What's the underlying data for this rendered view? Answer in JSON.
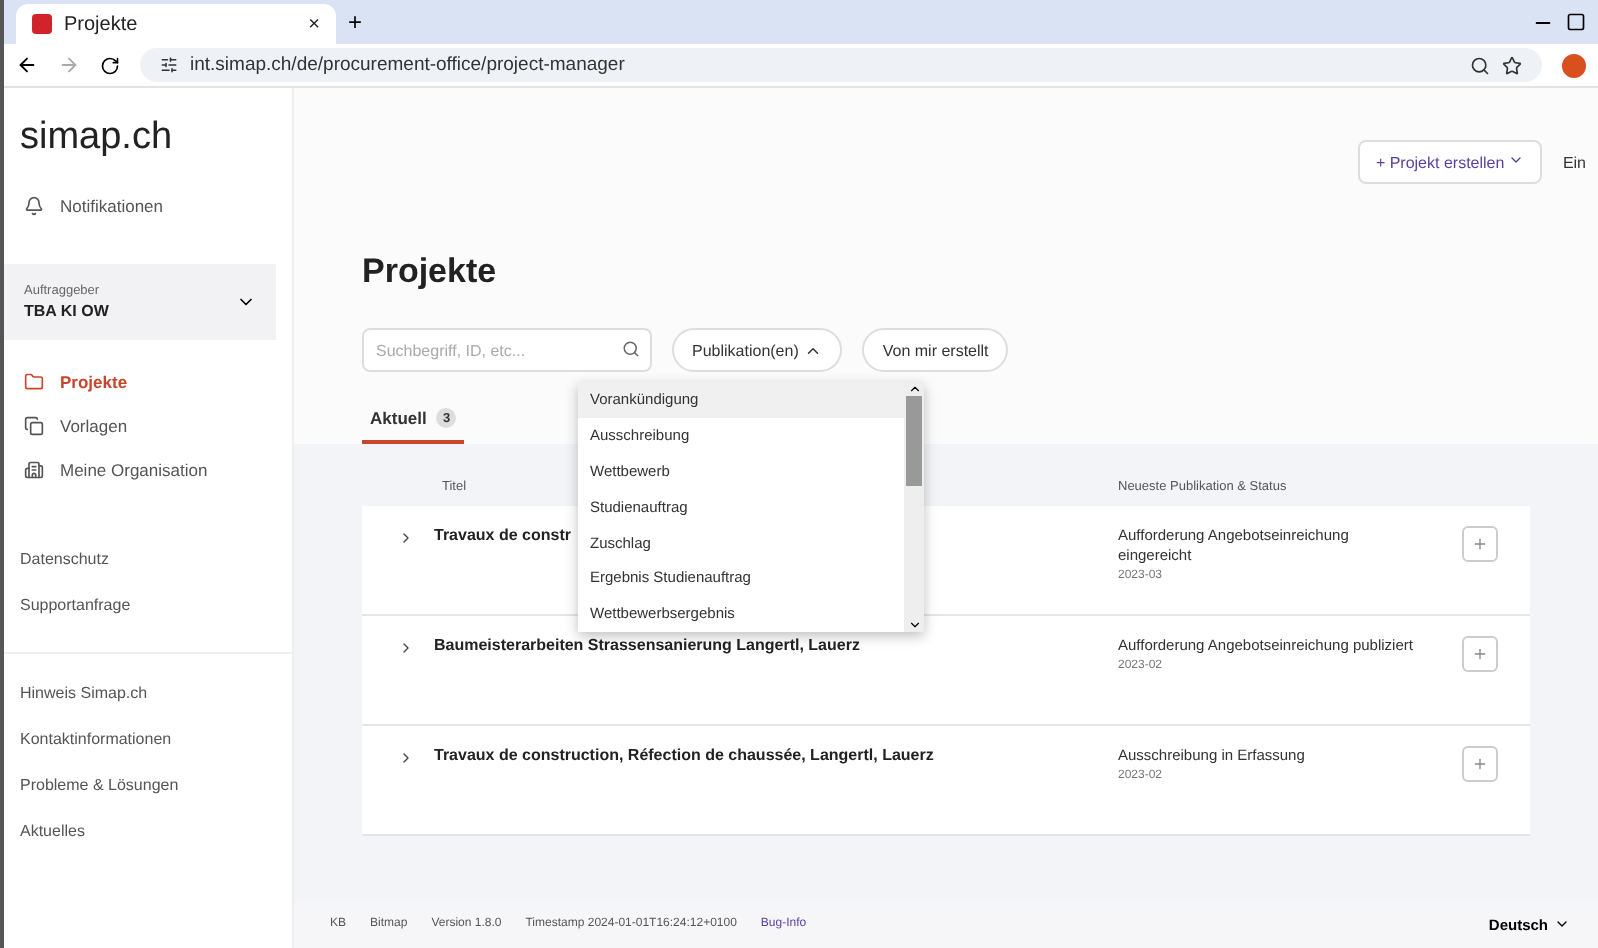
{
  "browser": {
    "tab_title": "Projekte",
    "tab_close": "×",
    "new_tab": "+",
    "url": "int.simap.ch/de/procurement-office/project-manager"
  },
  "sidebar": {
    "logo": "simap.ch",
    "notifications": "Notifikationen",
    "org": {
      "label": "Auftraggeber",
      "name": "TBA KI OW"
    },
    "nav": [
      {
        "label": "Projekte",
        "selected": true
      },
      {
        "label": "Vorlagen",
        "selected": false
      },
      {
        "label": "Meine Organisation",
        "selected": false
      }
    ],
    "links": [
      "Datenschutz",
      "Supportanfrage"
    ],
    "footer_links": [
      "Hinweis Simap.ch",
      "Kontaktinformationen",
      "Probleme & Lösungen",
      "Aktuelles"
    ]
  },
  "header": {
    "create_button": "+ Projekt erstellen",
    "user": "Ein"
  },
  "page": {
    "title": "Projekte",
    "search": {
      "placeholder": "Suchbegriff, ID, etc..."
    },
    "filter": "Publikation(en)",
    "mine": "Von mir erstellt",
    "tabs": [
      {
        "label": "Aktuell",
        "count": "3",
        "selected": true
      }
    ],
    "columns": [
      "Titel",
      "Neueste Publikation & Status"
    ],
    "rows": [
      {
        "title": "Travaux de constr",
        "status": "Aufforderung Angebotseinreichung eingereicht",
        "date": "2023-03"
      },
      {
        "title": "Baumeisterarbeiten Strassensanierung Langertl, Lauerz",
        "status": "Aufforderung Angebotseinreichung publiziert",
        "date": "2023-02"
      },
      {
        "title": "Travaux de construction, Réfection de chaussée, Langertl, Lauerz",
        "status": "Ausschreibung in Erfassung",
        "date": "2023-02"
      }
    ],
    "dropdown": [
      {
        "label": "Vorankündigung",
        "selected": true
      },
      {
        "label": "Ausschreibung",
        "selected": false
      },
      {
        "label": "Wettbewerb",
        "selected": false
      },
      {
        "label": "Studienauftrag",
        "selected": false
      },
      {
        "label": "Zuschlag",
        "selected": false
      },
      {
        "label": "Ergebnis Studienauftrag",
        "selected": false
      },
      {
        "label": "Wettbewerbsergebnis",
        "selected": false
      }
    ]
  },
  "footer": {
    "left": [
      "KB",
      "Bitmap",
      "Version 1.8.0",
      "Timestamp 2024-01-01T16:24:12+0100"
    ],
    "bug": "Bug-Info",
    "language": "Deutsch"
  }
}
